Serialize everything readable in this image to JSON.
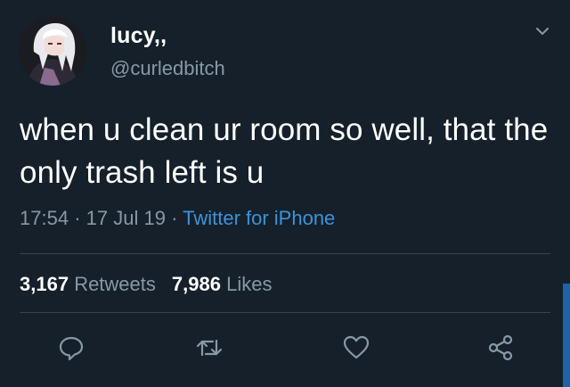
{
  "user": {
    "display_name": "lucy,,",
    "handle": "@curledbitch"
  },
  "tweet": {
    "text": "when u clean ur room so well, that the only trash left is u",
    "time": "17:54",
    "separator": "·",
    "date": "17 Jul 19",
    "source": "Twitter for iPhone"
  },
  "stats": {
    "retweets_count": "3,167",
    "retweets_label": "Retweets",
    "likes_count": "7,986",
    "likes_label": "Likes"
  },
  "icons": {
    "menu": "chevron-down-icon",
    "reply": "reply-icon",
    "retweet": "retweet-icon",
    "like": "heart-icon",
    "share": "share-icon"
  },
  "colors": {
    "background": "#15202b",
    "primary_text": "#ffffff",
    "secondary_text": "#8899a6",
    "link": "#3b94d9",
    "divider": "#38444d"
  }
}
